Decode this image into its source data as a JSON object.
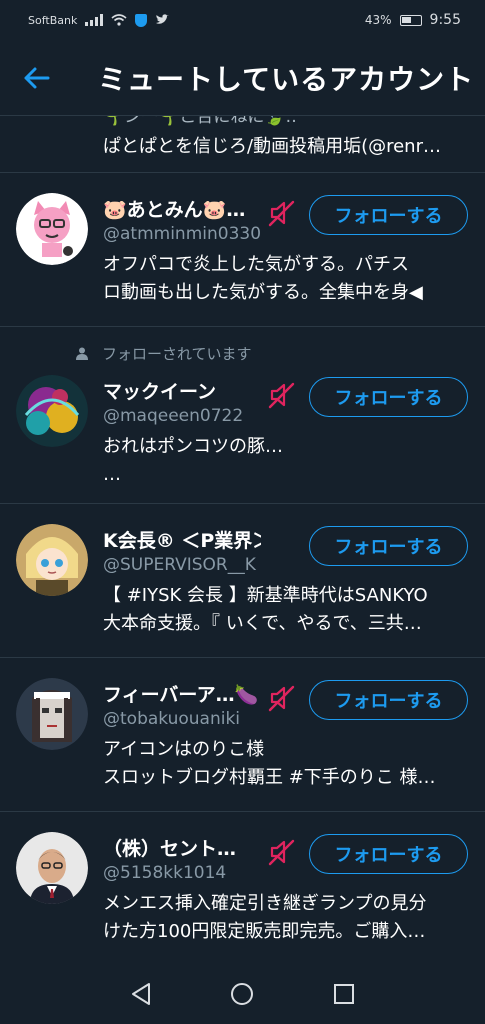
{
  "status_bar": {
    "carrier": "SoftBank",
    "battery": "43%",
    "time": "9:55"
  },
  "header": {
    "title": "ミュートしているアカウント"
  },
  "partial_row": {
    "top_text": "🌱ンー🌱こ合にねに🍃‥",
    "bio": "ぱとぱとを信じろ/動画投稿用垢(@renr…"
  },
  "accounts": [
    {
      "name": "🐷あとみん🐷…",
      "handle": "@atmminmin0330",
      "follow_label": "フォローする",
      "bio_lines": [
        "オフパコで炎上した気がする。パチス",
        "ロ動画も出した気がする。全集中を身◀"
      ]
    },
    {
      "followed_by": "フォローされています",
      "name": "マックイーン",
      "handle": "@maqeeen0722",
      "follow_label": "フォローする",
      "bio_lines": [
        "おれはポンコツの豚…",
        "…"
      ]
    },
    {
      "name": "K会長® ＜P業界＞#IY…",
      "handle": "@SUPERVISOR__K",
      "follow_label": "フォローする",
      "bio_lines": [
        "【 #IYSK 会長 】新基準時代はSANKYO",
        "大本命支援。『 いくで、やるで、三共…"
      ]
    },
    {
      "name": "フィーバーア…🍆",
      "handle": "@tobakuouaniki",
      "follow_label": "フォローする",
      "bio_lines": [
        "アイコンはのりこ様",
        "スロットブログ村覇王 #下手のりこ 様…"
      ]
    },
    {
      "name": "（株）セント…",
      "handle": "@5158kk1014",
      "follow_label": "フォローする",
      "bio_lines": [
        "メンエス挿入確定引き継ぎランプの見分",
        "けた方100円限定販売即完売。ご購入…"
      ]
    }
  ],
  "colors": {
    "background": "#15202b",
    "accent": "#1d9bf0",
    "mute": "#e0245e",
    "divider": "#2b3945",
    "secondary_text": "#8899a6"
  },
  "icons": [
    "back-arrow-icon",
    "mute-icon",
    "person-icon",
    "nav-back-icon",
    "nav-home-icon",
    "nav-recents-icon"
  ]
}
